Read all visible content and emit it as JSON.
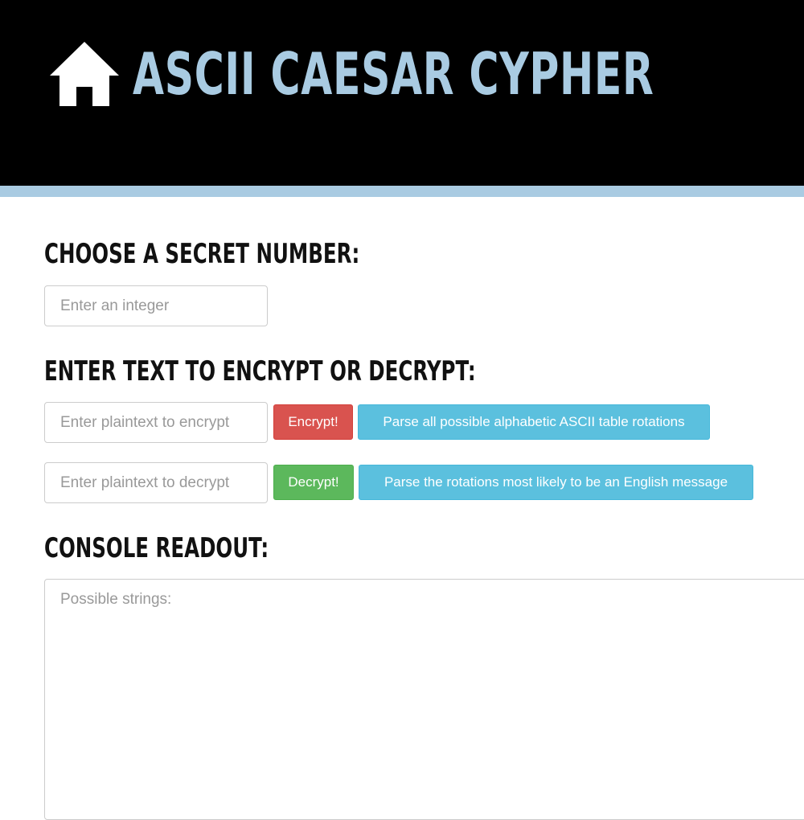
{
  "header": {
    "title": "ASCII CAESAR CYPHER",
    "home_icon": "home-icon",
    "background_color": "#000000",
    "accent_color": "#a9cbe2"
  },
  "secret_section": {
    "heading": "CHOOSE A SECRET NUMBER:",
    "input_value": "",
    "input_placeholder": "Enter an integer"
  },
  "text_section": {
    "heading": "ENTER TEXT TO ENCRYPT OR DECRYPT:",
    "encrypt_input_value": "",
    "encrypt_placeholder": "Enter plaintext to encrypt",
    "encrypt_button": "Encrypt!",
    "parse_all_button": "Parse all possible alphabetic ASCII table rotations",
    "decrypt_input_value": "",
    "decrypt_placeholder": "Enter plaintext to decrypt",
    "decrypt_button": "Decrypt!",
    "parse_english_button": "Parse the rotations most likely to be an English message"
  },
  "console_section": {
    "heading": "CONSOLE READOUT:",
    "value": "",
    "placeholder": "Possible strings:"
  },
  "colors": {
    "encrypt_button": "#d9534f",
    "decrypt_button": "#5cb85c",
    "info_button": "#5bc0de"
  }
}
